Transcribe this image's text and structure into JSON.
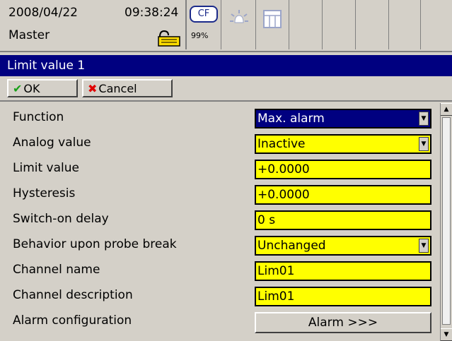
{
  "status": {
    "date": "2008/04/22",
    "time": "09:38:24",
    "user": "Master",
    "cf_label": "CF",
    "cf_percent": "99%",
    "icons": [
      "lock-icon",
      "alarm-bell-icon",
      "table-icon"
    ]
  },
  "window": {
    "title": "Limit value 1"
  },
  "buttons": {
    "ok_label": "OK",
    "cancel_label": "Cancel"
  },
  "form": {
    "rows": [
      {
        "label": "Function",
        "value": "Max. alarm",
        "type": "dropdown",
        "selected": true
      },
      {
        "label": "Analog value",
        "value": "Inactive",
        "type": "dropdown"
      },
      {
        "label": "Limit value",
        "value": "+0.0000",
        "type": "input"
      },
      {
        "label": "Hysteresis",
        "value": "+0.0000",
        "type": "input"
      },
      {
        "label": "Switch-on delay",
        "value": "0 s",
        "type": "input"
      },
      {
        "label": "Behavior upon probe break",
        "value": "Unchanged",
        "type": "dropdown"
      },
      {
        "label": "Channel name",
        "value": "Lim01",
        "type": "input"
      },
      {
        "label": "Channel description",
        "value": "Lim01",
        "type": "input"
      },
      {
        "label": "Alarm configuration",
        "value": "Alarm >>>",
        "type": "button"
      }
    ]
  },
  "colors": {
    "title_bg": "#000080",
    "field_bg": "#ffff00",
    "selected_bg": "#000080",
    "panel_bg": "#d4d0c8"
  }
}
